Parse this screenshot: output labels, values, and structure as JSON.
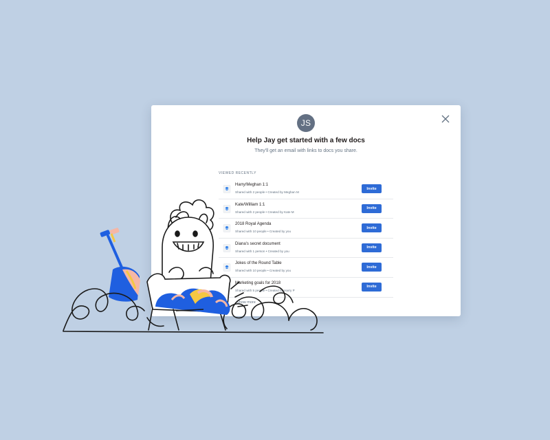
{
  "modal": {
    "avatar_initials": "JS",
    "title": "Help Jay get started with a few docs",
    "subtitle": "They'll get an email with links to docs you share.",
    "section_label": "VIEWED RECENTLY",
    "invite_label": "Invite",
    "show_more": "Show more",
    "docs": [
      {
        "name": "Harry/Meghan 1:1",
        "meta": "Shared with 2 people • Created by Meghan M"
      },
      {
        "name": "Kate/William 1:1",
        "meta": "Shared with 2 people • Created by Kate M"
      },
      {
        "name": "2018 Royal Agenda",
        "meta": "Shared with 10 people • Created by you"
      },
      {
        "name": "Diana's secret document",
        "meta": "Shared with 1 person • Created by you"
      },
      {
        "name": "Jokes of the Round Table",
        "meta": "Shared with 10 people • Created by you"
      },
      {
        "name": "Marketing goals for 2018",
        "meta": "Shared with 5 people • Created by Harry P"
      }
    ]
  },
  "colors": {
    "background": "#bfd0e4",
    "accent": "#2e6bd6",
    "avatar": "#637083"
  },
  "icons": {
    "close": "close-icon",
    "doc": "paper-doc-icon",
    "plus": "plus-icon"
  }
}
